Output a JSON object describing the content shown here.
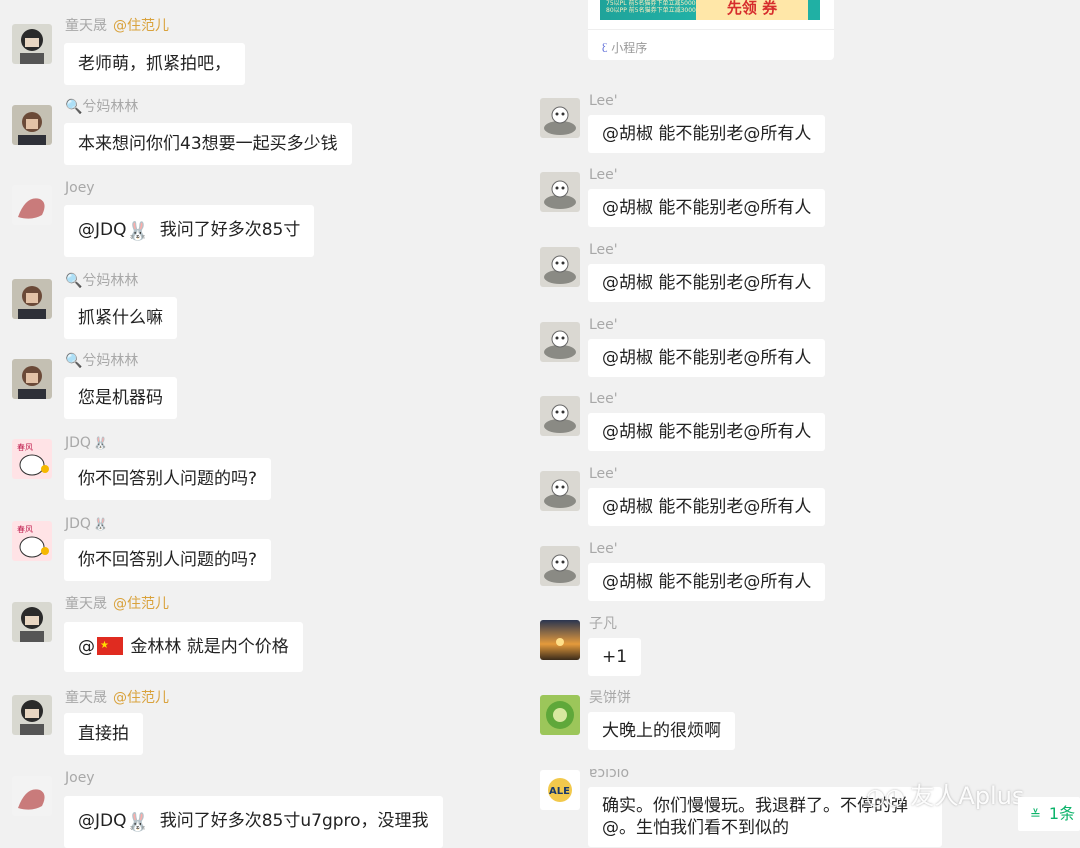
{
  "left_messages": [
    {
      "sender": "童天晟",
      "tag": "@住范儿",
      "text": "老师萌，抓紧拍吧，",
      "avatar": "boy"
    },
    {
      "sender": "🔍兮妈林林",
      "tag": "",
      "text": "本来想问你们43想要一起买多少钱",
      "avatar": "woman"
    },
    {
      "sender": "Joey",
      "tag": "",
      "pre": "@JDQ",
      "icon": "🐰",
      "text": "我问了好多次85寸",
      "avatar": "hand"
    },
    {
      "sender": "🔍兮妈林林",
      "tag": "",
      "text": "抓紧什么嘛",
      "avatar": "woman"
    },
    {
      "sender": "🔍兮妈林林",
      "tag": "",
      "text": "您是机器码",
      "avatar": "woman"
    },
    {
      "sender": "JDQ",
      "rabbit": "🐰",
      "text": "你不回答别人问题的吗?",
      "avatar": "rabbit"
    },
    {
      "sender": "JDQ",
      "rabbit": "🐰",
      "text": "你不回答别人问题的吗?",
      "avatar": "rabbit"
    },
    {
      "sender": "童天晟",
      "tag": "@住范儿",
      "pre": "@",
      "flag": true,
      "text": "金林林 就是内个价格",
      "avatar": "boy"
    },
    {
      "sender": "童天晟",
      "tag": "@住范儿",
      "text": "直接拍",
      "avatar": "boy"
    },
    {
      "sender": "Joey",
      "tag": "",
      "pre": "@JDQ",
      "icon": "🐰",
      "text": "我问了好多次85寸u7gpro，没理我",
      "avatar": "hand"
    }
  ],
  "mini_program": {
    "label": "小程序",
    "banner_left_line1": "75以PL 前5名猫券下单立减5000元",
    "banner_left_line2": "80以PP 前5名猫券下单立减3000元",
    "banner_right": "先领 券"
  },
  "right_messages": [
    {
      "sender": "Lee'",
      "text": "@胡椒 能不能别老@所有人",
      "avatar": "cat"
    },
    {
      "sender": "Lee'",
      "text": "@胡椒 能不能别老@所有人",
      "avatar": "cat"
    },
    {
      "sender": "Lee'",
      "text": "@胡椒 能不能别老@所有人",
      "avatar": "cat"
    },
    {
      "sender": "Lee'",
      "text": "@胡椒 能不能别老@所有人",
      "avatar": "cat"
    },
    {
      "sender": "Lee'",
      "text": "@胡椒 能不能别老@所有人",
      "avatar": "cat"
    },
    {
      "sender": "Lee'",
      "text": "@胡椒 能不能别老@所有人",
      "avatar": "cat"
    },
    {
      "sender": "Lee'",
      "text": "@胡椒 能不能别老@所有人",
      "avatar": "cat"
    },
    {
      "sender": "子凡",
      "text": "+1",
      "avatar": "sunset"
    },
    {
      "sender": "吴饼饼",
      "text": "大晚上的很烦啊",
      "avatar": "succulent"
    },
    {
      "sender": "ɐɔıɔıo",
      "text": "确实。你们慢慢玩。我退群了。不停的弹@。生怕我们看不到似的",
      "avatar": "badge"
    }
  ],
  "watermark": "友人Aplus",
  "unread": {
    "count": "1条"
  }
}
